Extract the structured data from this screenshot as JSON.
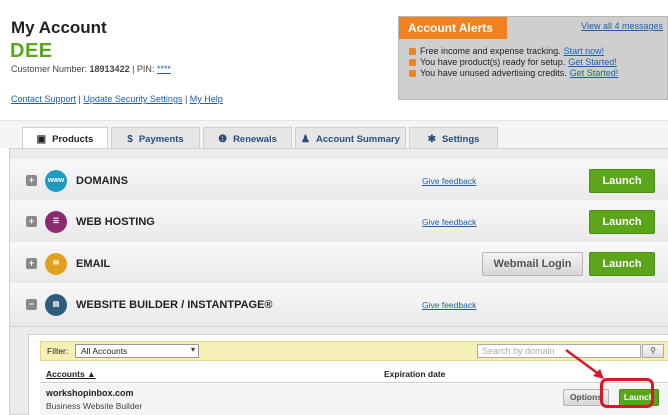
{
  "account": {
    "title": "My Account",
    "name": "DEE",
    "customer_label": "Customer Number: ",
    "customer_number": "18913422",
    "pin_label": " | PIN: ",
    "pin_value": "****",
    "links": {
      "contact": "Contact Support",
      "sep1": " | ",
      "security": "Update Security Settings",
      "sep2": " | ",
      "help": "My Help"
    }
  },
  "alerts": {
    "title": "Account Alerts",
    "view_all": "View all 4 messages",
    "items": [
      {
        "text": "Free income and expense tracking.",
        "link": "Start now!"
      },
      {
        "text": "You have product(s) ready for setup.",
        "link": "Get Started!"
      },
      {
        "text": "You have unused advertising credits.",
        "link": "Get Started!"
      }
    ]
  },
  "tabs": [
    {
      "label": "Products",
      "icon": "box-icon"
    },
    {
      "label": "Payments",
      "icon": "dollar-icon"
    },
    {
      "label": "Renewals",
      "icon": "alert-icon"
    },
    {
      "label": "Account Summary",
      "icon": "person-icon"
    },
    {
      "label": "Settings",
      "icon": "gear-icon"
    }
  ],
  "products": [
    {
      "name": "DOMAINS",
      "icon_text": "www",
      "icon_color": "#1f9bbf",
      "feedback": "Give feedback",
      "launch": "Launch"
    },
    {
      "name": "WEB HOSTING",
      "icon_text": "",
      "icon_color": "#8a2a73",
      "feedback": "Give feedback",
      "launch": "Launch"
    },
    {
      "name": "EMAIL",
      "icon_text": "",
      "icon_color": "#e0a020",
      "webmail": "Webmail Login",
      "launch": "Launch"
    },
    {
      "name": "WEBSITE BUILDER / INSTANTPAGE®",
      "icon_text": "",
      "icon_color": "#2f5d7c",
      "feedback": "Give feedback"
    }
  ],
  "builder": {
    "filter_label": "Filter:",
    "filter_value": "All Accounts",
    "search_placeholder": "Search by domain",
    "col_accounts": "Accounts ▲",
    "col_expiration": "Expiration date",
    "row": {
      "domain": "workshopinbox.com",
      "type": "Business Website Builder",
      "options": "Options",
      "launch": "Launch"
    }
  },
  "colors": {
    "accent_green": "#5aa51a",
    "alert_orange": "#f0821f",
    "link_blue": "#1a5fb4",
    "highlight_red": "#d8182a"
  }
}
